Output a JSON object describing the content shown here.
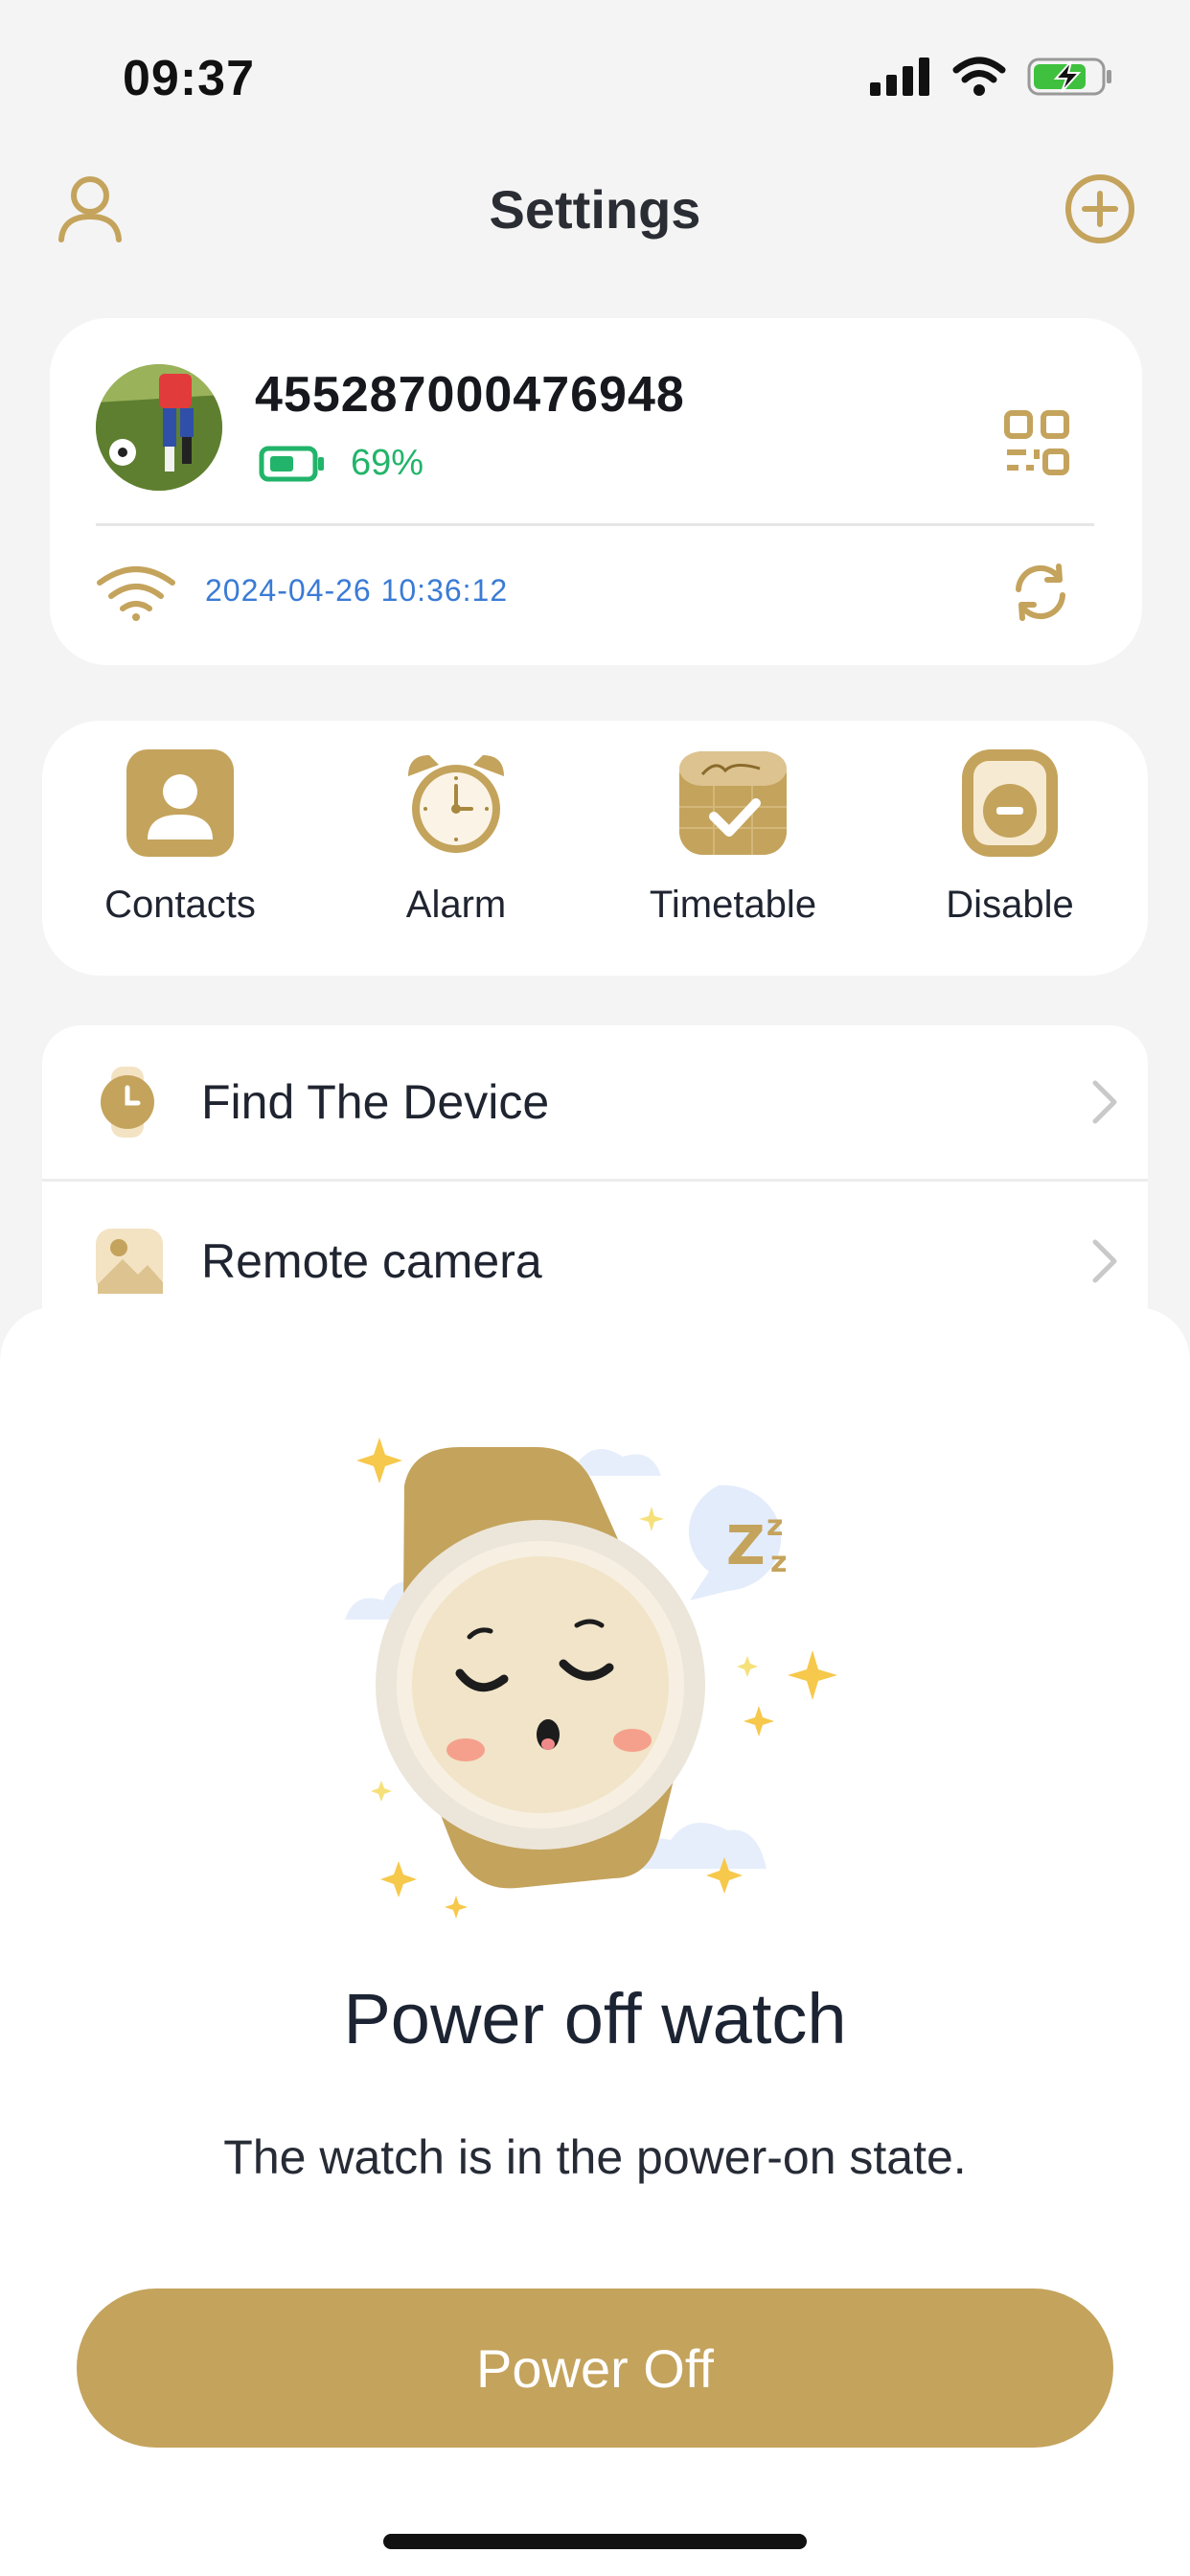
{
  "status_bar": {
    "time": "09:37"
  },
  "header": {
    "title": "Settings"
  },
  "device": {
    "id": "455287000476948",
    "battery": "69%",
    "last_update": "2024-04-26 10:36:12"
  },
  "actions": [
    {
      "label": "Contacts",
      "icon": "contacts-icon"
    },
    {
      "label": "Alarm",
      "icon": "alarm-clock-icon"
    },
    {
      "label": "Timetable",
      "icon": "timetable-icon"
    },
    {
      "label": "Disable",
      "icon": "disable-watch-icon"
    }
  ],
  "list": [
    {
      "label": "Find The Device",
      "icon": "find-watch-icon"
    },
    {
      "label": "Remote camera",
      "icon": "remote-camera-icon"
    }
  ],
  "sheet": {
    "title": "Power off watch",
    "description": "The watch is in the power-on state.",
    "button": "Power Off"
  },
  "colors": {
    "accent": "#c4a35c",
    "battery_green": "#22b46a",
    "timestamp_blue": "#3a7bd5"
  }
}
